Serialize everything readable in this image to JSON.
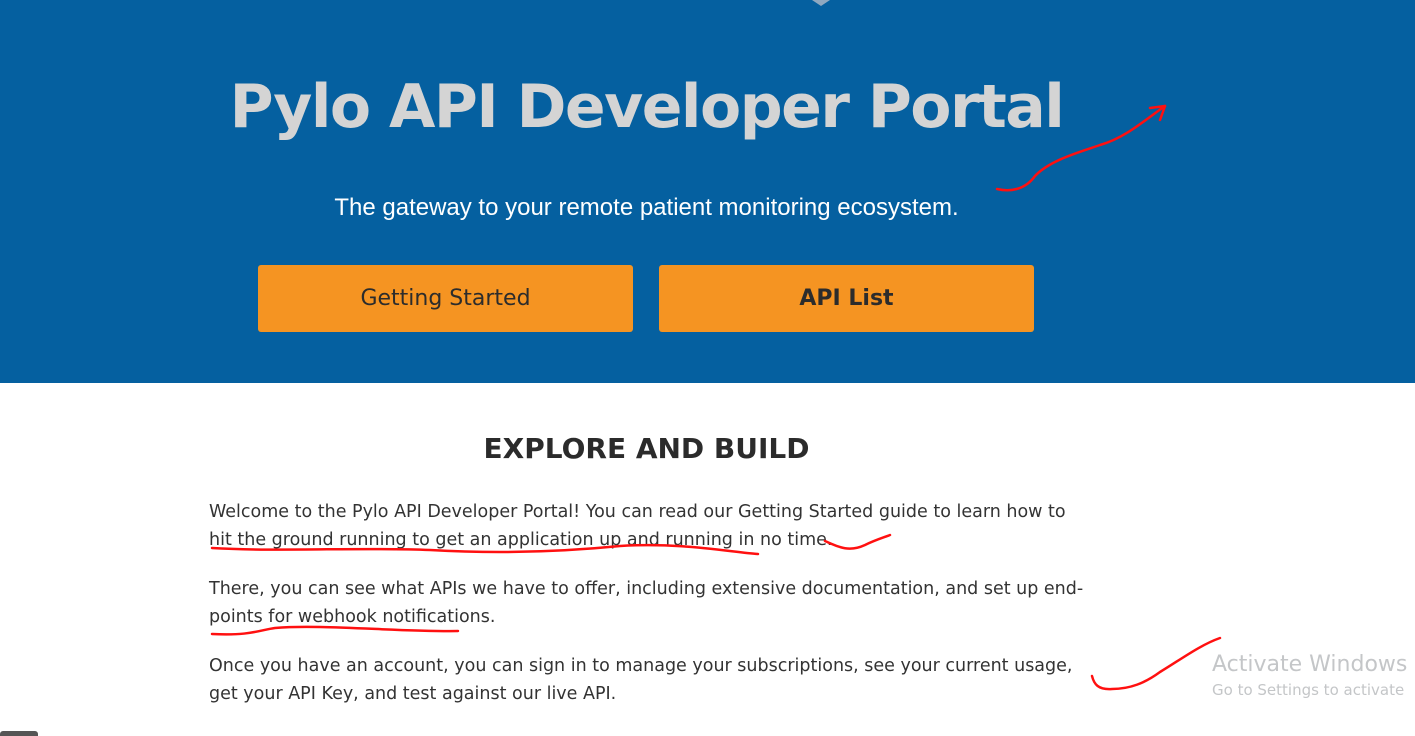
{
  "hero": {
    "title": "Pylo API Developer Portal",
    "subtitle": "The gateway to your remote patient monitoring ecosystem.",
    "buttons": {
      "getting_started": "Getting Started",
      "api_list": "API List"
    }
  },
  "explore": {
    "title": "EXPLORE AND BUILD",
    "paragraphs": [
      "Welcome to the Pylo API Developer Portal! You can read our Getting Started guide to learn how to hit the ground running to get an application up and running in no time.",
      "There, you can see what APIs we have to offer, including extensive documentation, and set up end-points for webhook notifications.",
      "Once you have an account, you can sign in to manage your subscriptions, see your current usage, get your API Key, and test against our live API."
    ]
  },
  "watermark": {
    "title": "Activate Windows",
    "subtitle": "Go to Settings to activate"
  },
  "colors": {
    "hero_background": "#0560a0",
    "button": "#f59422",
    "annotation_ink": "#ff0000"
  }
}
